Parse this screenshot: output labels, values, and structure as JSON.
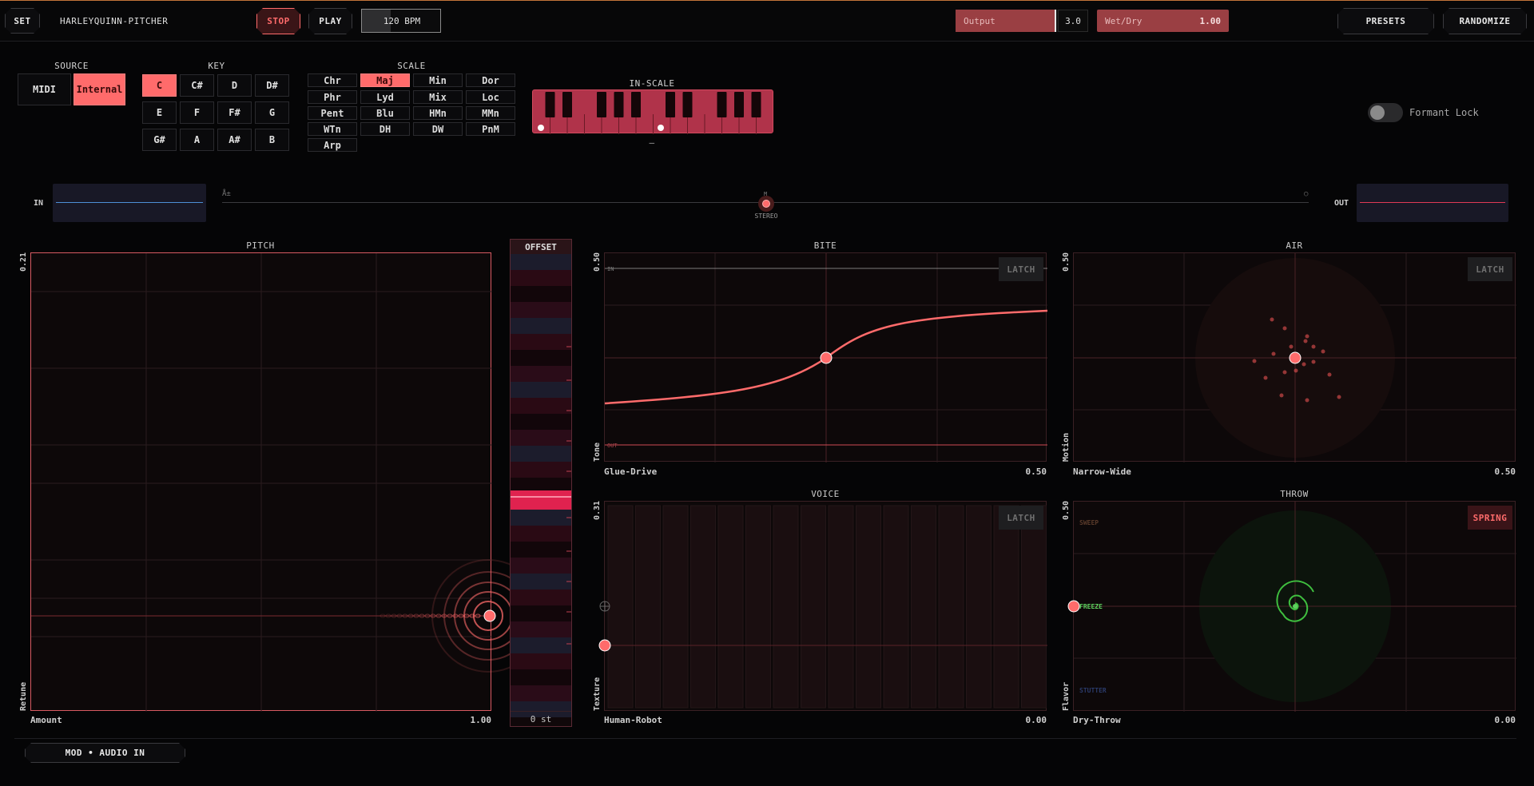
{
  "header": {
    "set_label": "SET",
    "app_title": "HARLEYQUINN-PITCHER",
    "stop_label": "STOP",
    "play_label": "PLAY",
    "bpm": "120 BPM",
    "output_label": "Output",
    "output_value": "3.0",
    "wetdry_label": "Wet/Dry",
    "wetdry_value": "1.00",
    "presets_label": "PRESETS",
    "randomize_label": "RANDOMIZE"
  },
  "source": {
    "title": "SOURCE",
    "options": [
      "MIDI",
      "Internal"
    ],
    "selected": "Internal"
  },
  "key": {
    "title": "KEY",
    "keys": [
      "C",
      "C#",
      "D",
      "D#",
      "E",
      "F",
      "F#",
      "G",
      "G#",
      "A",
      "A#",
      "B"
    ],
    "selected": "C"
  },
  "scale": {
    "title": "SCALE",
    "options": [
      "Chr",
      "Maj",
      "Min",
      "Dor",
      "Phr",
      "Lyd",
      "Mix",
      "Loc",
      "Pent",
      "Blu",
      "HMn",
      "MMn",
      "WTn",
      "DH",
      "DW",
      "PnM",
      "Arp"
    ],
    "selected": "Maj"
  },
  "inscale": {
    "title": "IN-SCALE",
    "sub": "–"
  },
  "formant": {
    "label": "Formant Lock",
    "on": false
  },
  "meters": {
    "in_label": "IN",
    "out_label": "OUT",
    "stereo_label": "STEREO",
    "left_glyph": "Å±",
    "center_glyph": "M",
    "right_glyph": "○"
  },
  "pitch": {
    "title": "PITCH",
    "y_value": "0.21",
    "y_label": "Retune",
    "x_label": "Amount",
    "x_value": "1.00"
  },
  "offset": {
    "title": "OFFSET",
    "value": "0 st"
  },
  "bite": {
    "title": "BITE",
    "y_value": "0.50",
    "y_label": "Tone",
    "x_label": "Glue-Drive",
    "x_value": "0.50",
    "latch": "LATCH",
    "in_tag": "IN",
    "out_tag": "OUT"
  },
  "air": {
    "title": "AIR",
    "y_value": "0.50",
    "y_label": "Motion",
    "x_label": "Narrow-Wide",
    "x_value": "0.50",
    "latch": "LATCH"
  },
  "voice": {
    "title": "VOICE",
    "y_value": "0.31",
    "y_label": "Texture",
    "x_label": "Human-Robot",
    "x_value": "0.00",
    "latch": "LATCH"
  },
  "throw": {
    "title": "THROW",
    "y_value": "0.50",
    "y_label": "Flavor",
    "x_label": "Dry-Throw",
    "x_value": "0.00",
    "spring": "SPRING",
    "sweep": "SWEEP",
    "freeze": "FREEZE",
    "stutter": "STUTTER"
  },
  "footer": {
    "mod_label": "MOD • AUDIO IN"
  },
  "colors": {
    "accent": "#ff6b6b",
    "accent_deep": "#e0224f",
    "green": "#3fbf3f",
    "bg": "#050506"
  }
}
